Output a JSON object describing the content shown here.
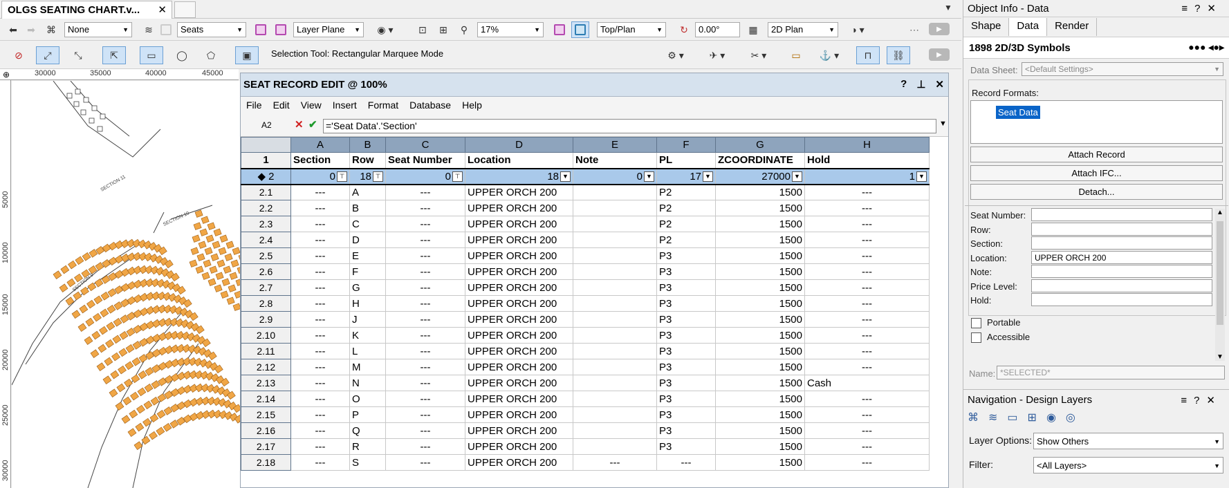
{
  "colors": {
    "accent": "#0a64c8",
    "sum_row": "#a9c9ea",
    "col_header": "#8ea4bd"
  },
  "doc_tab": {
    "title": "OLGS SEATING CHART.v...",
    "close": "✕"
  },
  "toolbar1": {
    "class_value": "None",
    "layer_value": "Seats",
    "plane_value": "Layer Plane",
    "zoom_value": "17%",
    "view_value": "Top/Plan",
    "rotation_value": "0.00°",
    "render_value": "2D Plan"
  },
  "toolbar2": {
    "status": "Selection Tool: Rectangular Marquee Mode"
  },
  "ruler": {
    "h": [
      "30000",
      "35000",
      "40000",
      "45000"
    ],
    "v": [
      "5000",
      "10000",
      "15000",
      "20000",
      "25000",
      "30000"
    ]
  },
  "worksheet": {
    "title": "SEAT RECORD EDIT @ 100%",
    "controls": [
      "?",
      "⊥",
      "✕"
    ],
    "menu": [
      "File",
      "Edit",
      "View",
      "Insert",
      "Format",
      "Database",
      "Help"
    ],
    "cell_ref": "A2",
    "formula": "='Seat Data'.'Section'",
    "columns": [
      "A",
      "B",
      "C",
      "D",
      "E",
      "F",
      "G",
      "H"
    ],
    "headers": [
      "Section",
      "Row",
      "Seat Number",
      "Location",
      "Note",
      "PL",
      "ZCOORDINATE",
      "Hold"
    ],
    "sum_row": {
      "label": "2",
      "values": [
        "0",
        "18",
        "0",
        "18",
        "0",
        "17",
        "27000",
        "1"
      ]
    },
    "rows": [
      {
        "id": "2.1",
        "cells": [
          "---",
          "A",
          "---",
          "UPPER ORCH 200",
          "",
          "P2",
          "1500",
          "---"
        ]
      },
      {
        "id": "2.2",
        "cells": [
          "---",
          "B",
          "---",
          "UPPER ORCH 200",
          "",
          "P2",
          "1500",
          "---"
        ]
      },
      {
        "id": "2.3",
        "cells": [
          "---",
          "C",
          "---",
          "UPPER ORCH 200",
          "",
          "P2",
          "1500",
          "---"
        ]
      },
      {
        "id": "2.4",
        "cells": [
          "---",
          "D",
          "---",
          "UPPER ORCH 200",
          "",
          "P2",
          "1500",
          "---"
        ]
      },
      {
        "id": "2.5",
        "cells": [
          "---",
          "E",
          "---",
          "UPPER ORCH 200",
          "",
          "P3",
          "1500",
          "---"
        ]
      },
      {
        "id": "2.6",
        "cells": [
          "---",
          "F",
          "---",
          "UPPER ORCH 200",
          "",
          "P3",
          "1500",
          "---"
        ]
      },
      {
        "id": "2.7",
        "cells": [
          "---",
          "G",
          "---",
          "UPPER ORCH 200",
          "",
          "P3",
          "1500",
          "---"
        ]
      },
      {
        "id": "2.8",
        "cells": [
          "---",
          "H",
          "---",
          "UPPER ORCH 200",
          "",
          "P3",
          "1500",
          "---"
        ]
      },
      {
        "id": "2.9",
        "cells": [
          "---",
          "J",
          "---",
          "UPPER ORCH 200",
          "",
          "P3",
          "1500",
          "---"
        ]
      },
      {
        "id": "2.10",
        "cells": [
          "---",
          "K",
          "---",
          "UPPER ORCH 200",
          "",
          "P3",
          "1500",
          "---"
        ]
      },
      {
        "id": "2.11",
        "cells": [
          "---",
          "L",
          "---",
          "UPPER ORCH 200",
          "",
          "P3",
          "1500",
          "---"
        ]
      },
      {
        "id": "2.12",
        "cells": [
          "---",
          "M",
          "---",
          "UPPER ORCH 200",
          "",
          "P3",
          "1500",
          "---"
        ]
      },
      {
        "id": "2.13",
        "cells": [
          "---",
          "N",
          "---",
          "UPPER ORCH 200",
          "",
          "P3",
          "1500",
          "Cash"
        ]
      },
      {
        "id": "2.14",
        "cells": [
          "---",
          "O",
          "---",
          "UPPER ORCH 200",
          "",
          "P3",
          "1500",
          "---"
        ]
      },
      {
        "id": "2.15",
        "cells": [
          "---",
          "P",
          "---",
          "UPPER ORCH 200",
          "",
          "P3",
          "1500",
          "---"
        ]
      },
      {
        "id": "2.16",
        "cells": [
          "---",
          "Q",
          "---",
          "UPPER ORCH 200",
          "",
          "P3",
          "1500",
          "---"
        ]
      },
      {
        "id": "2.17",
        "cells": [
          "---",
          "R",
          "---",
          "UPPER ORCH 200",
          "",
          "P3",
          "1500",
          "---"
        ]
      },
      {
        "id": "2.18",
        "cells": [
          "---",
          "S",
          "---",
          "UPPER ORCH 200",
          "---",
          "---",
          "1500",
          "---"
        ]
      }
    ]
  },
  "object_info": {
    "title": "Object Info - Data",
    "tabs": [
      "Shape",
      "Data",
      "Render"
    ],
    "kind": "1898 2D/3D Symbols",
    "data_sheet_label": "Data Sheet:",
    "data_sheet_value": "<Default Settings>",
    "record_formats_label": "Record Formats:",
    "record_selected": "Seat Data",
    "buttons": [
      "Attach Record",
      "Attach IFC...",
      "Detach..."
    ],
    "fields": [
      {
        "label": "Seat Number:",
        "value": ""
      },
      {
        "label": "Row:",
        "value": ""
      },
      {
        "label": "Section:",
        "value": ""
      },
      {
        "label": "Location:",
        "value": "UPPER ORCH 200"
      },
      {
        "label": "Note:",
        "value": ""
      },
      {
        "label": "Price Level:",
        "value": ""
      },
      {
        "label": "Hold:",
        "value": ""
      }
    ],
    "checkboxes": [
      "Portable",
      "Accessible"
    ],
    "name_label": "Name:",
    "name_placeholder": "*SELECTED*"
  },
  "navigation": {
    "title": "Navigation - Design Layers",
    "layer_options_label": "Layer Options:",
    "layer_options_value": "Show Others",
    "filter_label": "Filter:",
    "filter_value": "<All Layers>"
  }
}
